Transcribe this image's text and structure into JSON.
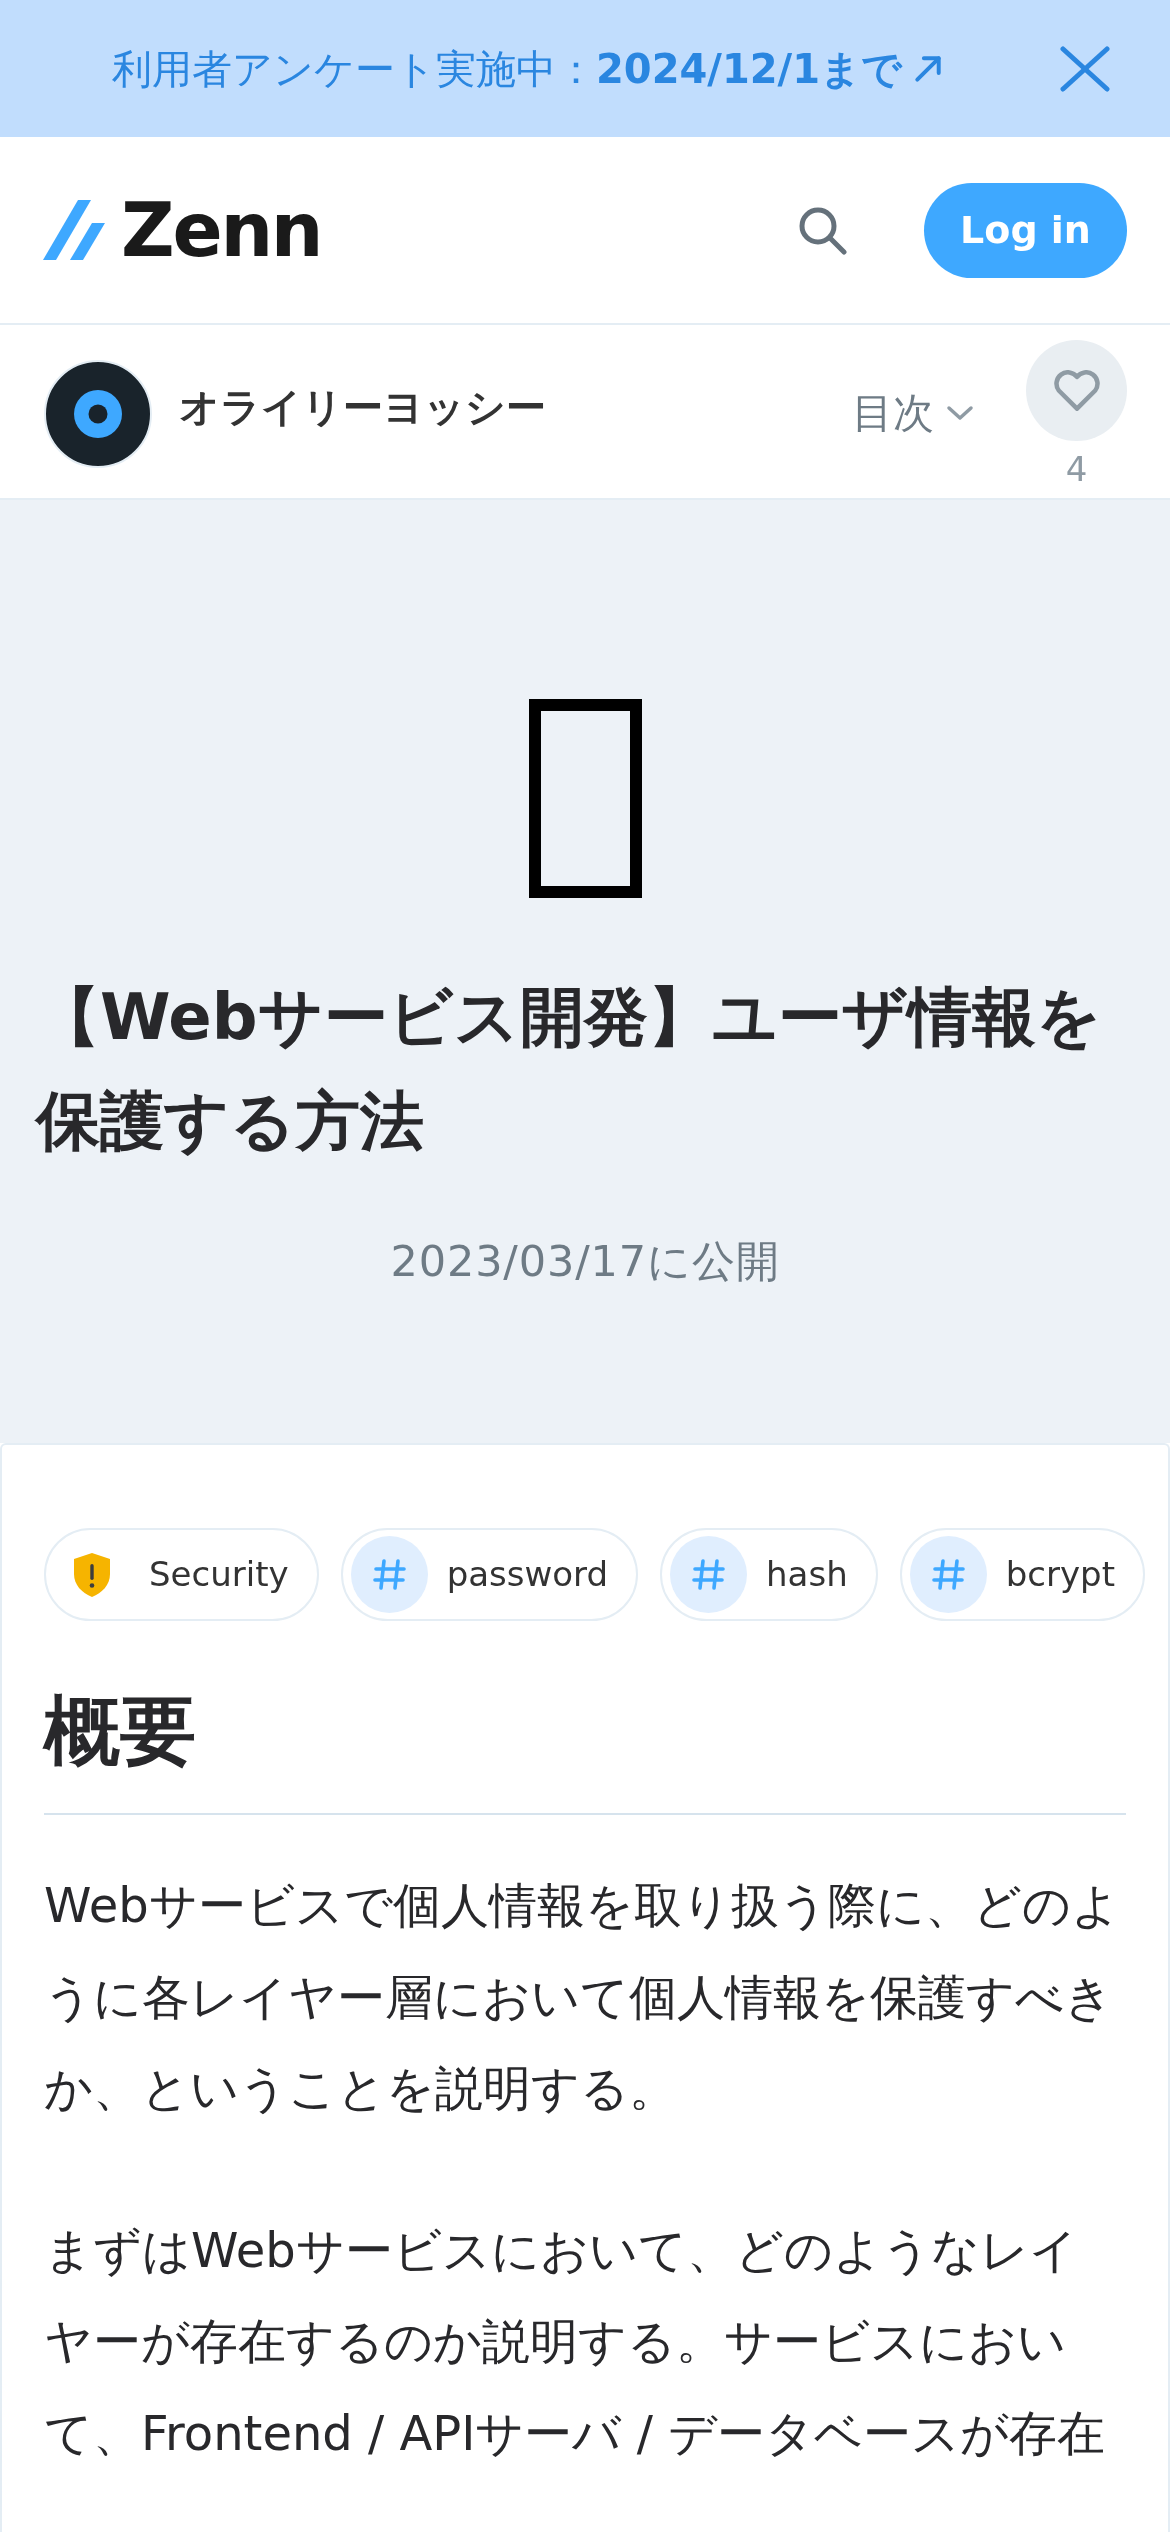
{
  "banner": {
    "text": "利用者アンケート実施中：**2024/12/1まで**"
  },
  "header": {
    "logo": "Zenn",
    "login_button": "Log in"
  },
  "author_bar": {
    "author_name": "オライリーヨッシー",
    "toc_button": "目次",
    "like_count": "4"
  },
  "article": {
    "title": "【Webサービス開発】ユーザ情報を保護する方法",
    "published": "2023/03/17に公開",
    "topics": [
      {
        "kind": "shield",
        "label": "Security"
      },
      {
        "kind": "hash",
        "label": "password"
      },
      {
        "kind": "hash",
        "label": "hash"
      },
      {
        "kind": "hash",
        "label": "bcrypt"
      }
    ],
    "body": [
      {
        "kind": "heading",
        "text": "概要"
      },
      {
        "kind": "paragraph",
        "text": "Webサービスで個人情報を取り扱う際に、どのように各レイヤー層において個人情報を保護すべきか、ということを説明する。"
      },
      {
        "kind": "paragraph",
        "text": "まずはWebサービスにおいて、どのようなレイヤーが存在するのか説明する。サービスにおいて、Frontend / APIサーバ / データベースが存在"
      }
    ]
  }
}
